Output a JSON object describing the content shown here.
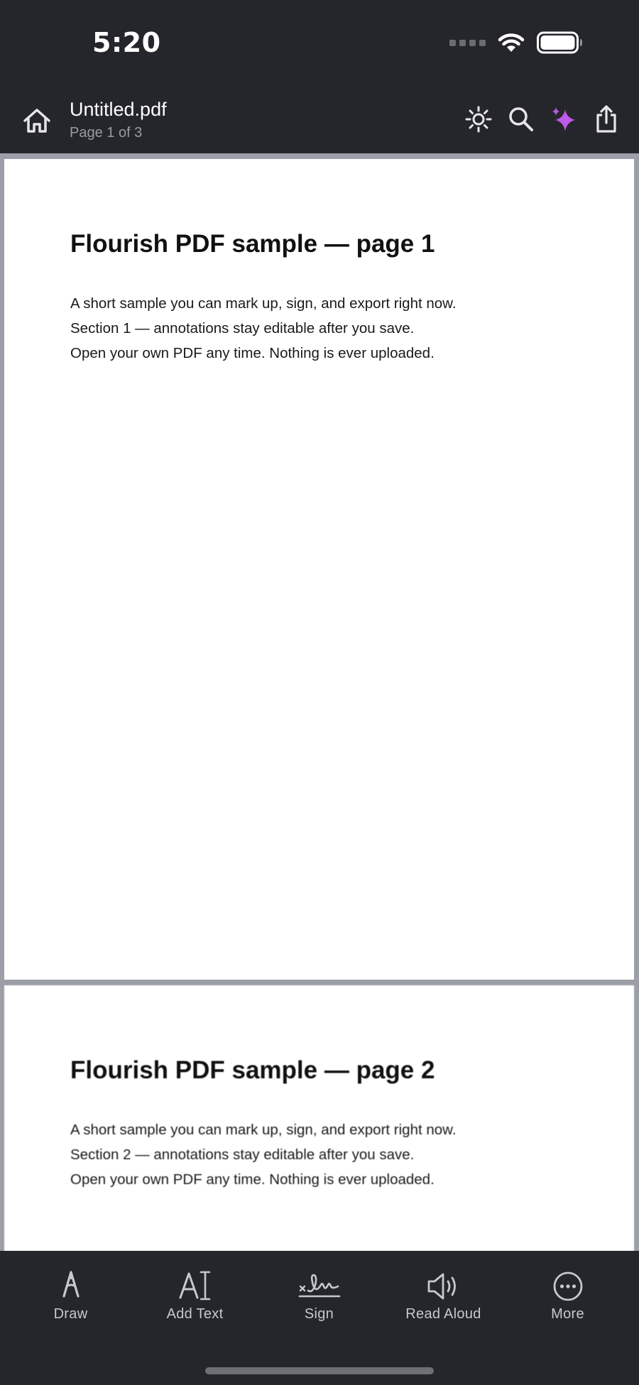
{
  "status_bar": {
    "time": "5:20"
  },
  "app_bar": {
    "title": "Untitled.pdf",
    "subtitle": "Page 1 of 3",
    "accent_color": "#c05ae8"
  },
  "pages": [
    {
      "heading": "Flourish PDF sample — page 1",
      "lines": [
        "A short sample you can mark up, sign, and export right now.",
        "Section 1 — annotations stay editable after you save.",
        "Open your own PDF any time. Nothing is ever uploaded."
      ]
    },
    {
      "heading": "Flourish PDF sample — page 2",
      "lines": [
        "A short sample you can mark up, sign, and export right now.",
        "Section 2 — annotations stay editable after you save.",
        "Open your own PDF any time. Nothing is ever uploaded."
      ]
    }
  ],
  "toolbar": {
    "draw_label": "Draw",
    "add_text_label": "Add Text",
    "sign_label": "Sign",
    "read_aloud_label": "Read Aloud",
    "more_label": "More"
  }
}
